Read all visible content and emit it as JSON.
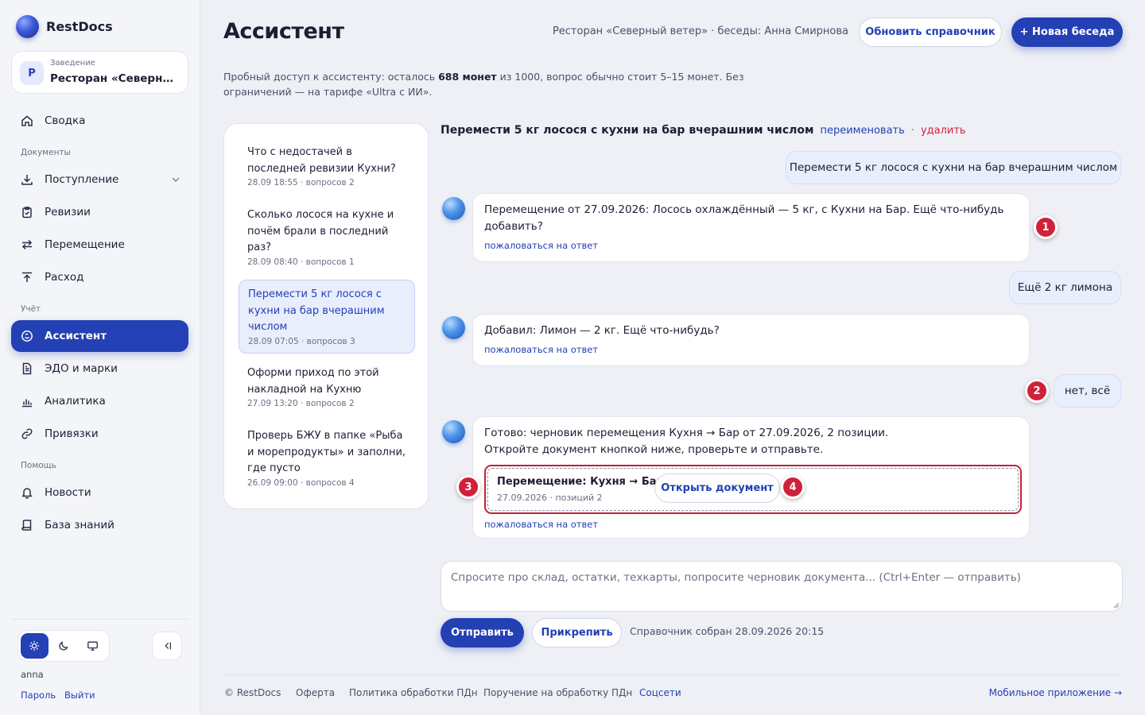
{
  "brand": {
    "name": "RestDocs"
  },
  "venue": {
    "caption": "Заведение",
    "avatar_letter": "Р",
    "name": "Ресторан «Северный ветер»"
  },
  "nav": {
    "summary": "Сводка",
    "section_documents": "Документы",
    "receipts": "Поступление",
    "audits": "Ревизии",
    "transfer": "Перемещение",
    "expense": "Расход",
    "section_accounting": "Учёт",
    "assistant": "Ассистент",
    "edo": "ЭДО и марки",
    "analytics": "Аналитика",
    "bindings": "Привязки",
    "section_help": "Помощь",
    "news": "Новости",
    "knowledge": "База знаний"
  },
  "sidebar_footer": {
    "username": "anna",
    "password_link": "Пароль",
    "logout_link": "Выйти"
  },
  "header": {
    "title": "Ассистент",
    "meta": "Ресторан «Северный ветер» · беседы: Анна Смирнова",
    "refresh_button": "Обновить справочник",
    "new_chat_button": "+ Новая беседа"
  },
  "trial": {
    "prefix": "Пробный доступ к ассистенту: осталось ",
    "coins": "688 монет",
    "suffix": " из 1000, вопрос обычно стоит 5–15 монет. Без ограничений — на тарифе «Ultra с ИИ»."
  },
  "history": [
    {
      "title": "Что с недостачей в последней ревизии Кухни?",
      "meta": "28.09 18:55 · вопросов 2"
    },
    {
      "title": "Сколько лосося на кухне и почём брали в последний раз?",
      "meta": "28.09 08:40 · вопросов 1"
    },
    {
      "title": "Перемести 5 кг лосося с кухни на бар вчерашним числом",
      "meta": "28.09 07:05 · вопросов 3"
    },
    {
      "title": "Оформи приход по этой накладной на Кухню",
      "meta": "27.09 13:20 · вопросов 2"
    },
    {
      "title": "Проверь БЖУ в папке «Рыба и морепродукты» и заполни, где пусто",
      "meta": "26.09 09:00 · вопросов 4"
    }
  ],
  "conversation": {
    "title": "Перемести 5 кг лосося с кухни на бар вчерашним числом",
    "rename_link": "переименовать",
    "separator": "·",
    "delete_link": "удалить",
    "user_msg_1": "Перемести 5 кг лосося с кухни на бар вчерашним числом",
    "bot_msg_1": "Перемещение от 27.09.2026: Лосось охлаждённый — 5 кг, с Кухни на Бар. Ещё что-нибудь добавить?",
    "user_msg_2": "Ещё 2 кг лимона",
    "bot_msg_2": "Добавил: Лимон — 2 кг. Ещё что-нибудь?",
    "user_msg_3": "нет, всё",
    "bot_msg_3_line1": "Готово: черновик перемещения Кухня → Бар от 27.09.2026, 2 позиции.",
    "bot_msg_3_line2": "Откройте документ кнопкой ниже, проверьте и отправьте.",
    "complain_link": "пожаловаться на ответ",
    "doc_card": {
      "title": "Перемещение: Кухня → Бар",
      "meta": "27.09.2026 · позиций 2",
      "open_button": "Открыть документ"
    }
  },
  "badges": {
    "b1": "1",
    "b2": "2",
    "b3": "3",
    "b4": "4"
  },
  "composer": {
    "placeholder": "Спросите про склад, остатки, техкарты, попросите черновик документа... (Ctrl+Enter — отправить)",
    "send_button": "Отправить",
    "attach_button": "Прикрепить",
    "reference_note": "Справочник собран 28.09.2026 20:15"
  },
  "footer": {
    "copyright": "© RestDocs",
    "offer": "Оферта",
    "privacy": "Политика обработки ПДн",
    "assignment": "Поручение на обработку ПДн",
    "social": "Соцсети",
    "mobile": "Мобильное приложение →"
  },
  "colors": {
    "accent": "#2340b4",
    "danger": "#d1213a",
    "background": "#eef0f6"
  },
  "icons": [
    "home-icon",
    "download-icon",
    "clipboard-icon",
    "arrows-swap-icon",
    "upload-icon",
    "assistant-icon",
    "document-icon",
    "bar-chart-icon",
    "link-icon",
    "bell-icon",
    "book-icon",
    "sun-icon",
    "moon-icon",
    "monitor-icon",
    "collapse-icon"
  ]
}
